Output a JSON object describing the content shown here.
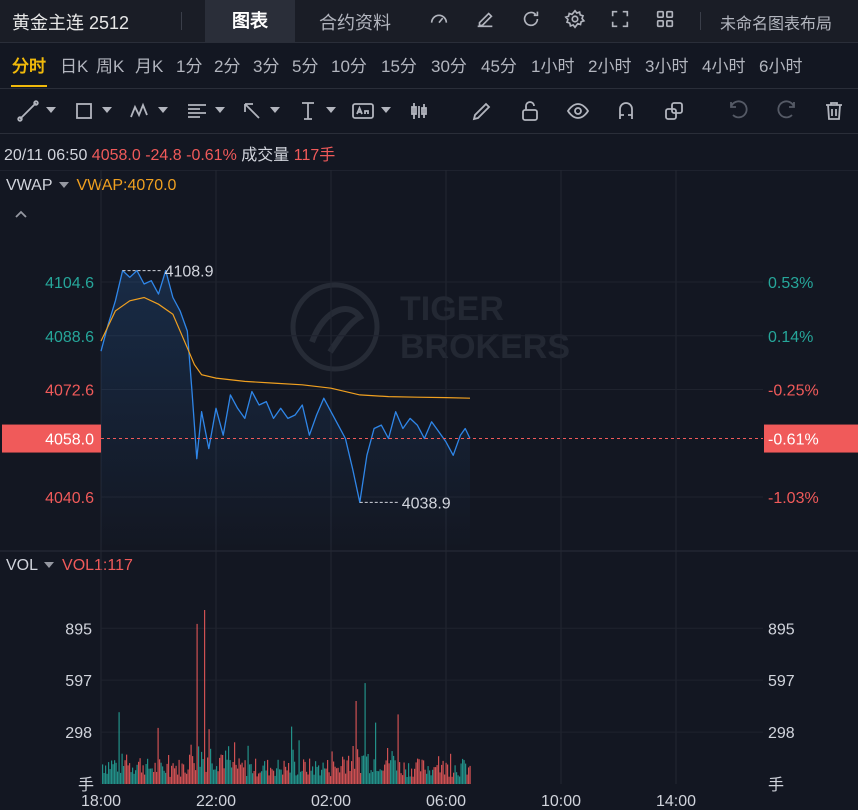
{
  "header": {
    "title": "黄金主连 2512",
    "tabs": [
      "图表",
      "合约资料"
    ],
    "layout_name": "未命名图表布局"
  },
  "periods": [
    "分时",
    "日K",
    "周K",
    "月K",
    "1分",
    "2分",
    "3分",
    "5分",
    "10分",
    "15分",
    "30分",
    "45分",
    "1小时",
    "2小时",
    "3小时",
    "4小时",
    "6小时"
  ],
  "active_period": "分时",
  "info": {
    "datetime": "20/11 06:50",
    "price": "4058.0",
    "change": "-24.8",
    "change_pct": "-0.61%",
    "volume_label": "成交量",
    "volume": "117手"
  },
  "indicator": {
    "name": "VWAP",
    "value_text": "VWAP:4070.0"
  },
  "volume_indicator": {
    "name": "VOL",
    "value_text": "VOL1:117"
  },
  "colors": {
    "up": "#26a69a",
    "down": "#f05a5a",
    "price_line": "#2f86e8",
    "vwap_line": "#f0a020",
    "accent": "#f0b90b"
  },
  "watermark": "TIGER BROKERS",
  "chart_data": [
    {
      "type": "line",
      "price_axis": {
        "ticks": [
          "4104.6",
          "4088.6",
          "4072.6",
          "4040.6"
        ],
        "ylim": [
          4025,
          4122
        ]
      },
      "pct_axis": {
        "ticks": [
          "0.53%",
          "0.14%",
          "-0.25%",
          "-1.03%"
        ]
      },
      "current_price_label": "4058.0",
      "current_pct_label": "-0.61%",
      "high_label": "4108.9",
      "low_label": "4038.9",
      "x_ticks": [
        "18:00",
        "22:00",
        "02:00",
        "06:00",
        "10:00",
        "14:00"
      ],
      "series": [
        {
          "x": [
            "18:00",
            "18:15",
            "18:30",
            "18:45",
            "19:00",
            "19:15",
            "19:30",
            "19:45",
            "20:00",
            "20:15",
            "20:30",
            "20:45",
            "21:00",
            "21:10",
            "21:20",
            "21:30",
            "21:45",
            "22:00",
            "22:15",
            "22:30",
            "22:45",
            "23:00",
            "23:15",
            "23:30",
            "23:45",
            "00:00",
            "00:15",
            "00:30",
            "00:45",
            "01:00",
            "01:15",
            "01:30",
            "01:45",
            "02:00",
            "02:15",
            "02:30",
            "02:45",
            "03:00",
            "03:15",
            "03:30",
            "03:45",
            "04:00",
            "04:15",
            "04:30",
            "04:45",
            "05:00",
            "05:15",
            "05:30",
            "05:45",
            "06:00",
            "06:15",
            "06:30",
            "06:40",
            "06:50"
          ],
          "values": [
            4084,
            4092,
            4099,
            4108,
            4106,
            4108,
            4104,
            4105,
            4101,
            4108,
            4100,
            4096,
            4090,
            4072,
            4052,
            4066,
            4055,
            4067,
            4059,
            4071,
            4067,
            4064,
            4072,
            4068,
            4069,
            4064,
            4067,
            4064,
            4065,
            4068,
            4059,
            4065,
            4070,
            4066,
            4062,
            4058,
            4049,
            4039,
            4053,
            4061,
            4062,
            4058,
            4066,
            4061,
            4064,
            4062,
            4058,
            4063,
            4060,
            4057,
            4053,
            4059,
            4061,
            4058
          ]
        },
        {
          "name": "VWAP",
          "x": [
            "18:00",
            "18:30",
            "19:00",
            "19:30",
            "20:00",
            "20:30",
            "21:00",
            "21:15",
            "21:30",
            "22:00",
            "23:00",
            "00:00",
            "01:00",
            "02:00",
            "03:00",
            "04:00",
            "05:00",
            "06:00",
            "06:50"
          ],
          "values": [
            4087,
            4096,
            4099,
            4100,
            4098,
            4095,
            4085,
            4080,
            4077,
            4076,
            4075,
            4074.5,
            4074,
            4073,
            4071,
            4070.5,
            4070.3,
            4070.2,
            4070.0
          ]
        }
      ]
    },
    {
      "type": "bar",
      "ylabel": "手",
      "y_ticks": [
        "895",
        "597",
        "298"
      ],
      "ylim": [
        0,
        1000
      ],
      "x_ticks": [
        "18:00",
        "22:00",
        "02:00",
        "06:00",
        "10:00",
        "14:00"
      ],
      "peaks": [
        {
          "x": "21:35",
          "value": 1000
        },
        {
          "x": "21:20",
          "value": 920
        },
        {
          "x": "03:10",
          "value": 580
        },
        {
          "x": "01:10",
          "value": 430
        },
        {
          "x": "04:20",
          "value": 400
        }
      ]
    }
  ]
}
